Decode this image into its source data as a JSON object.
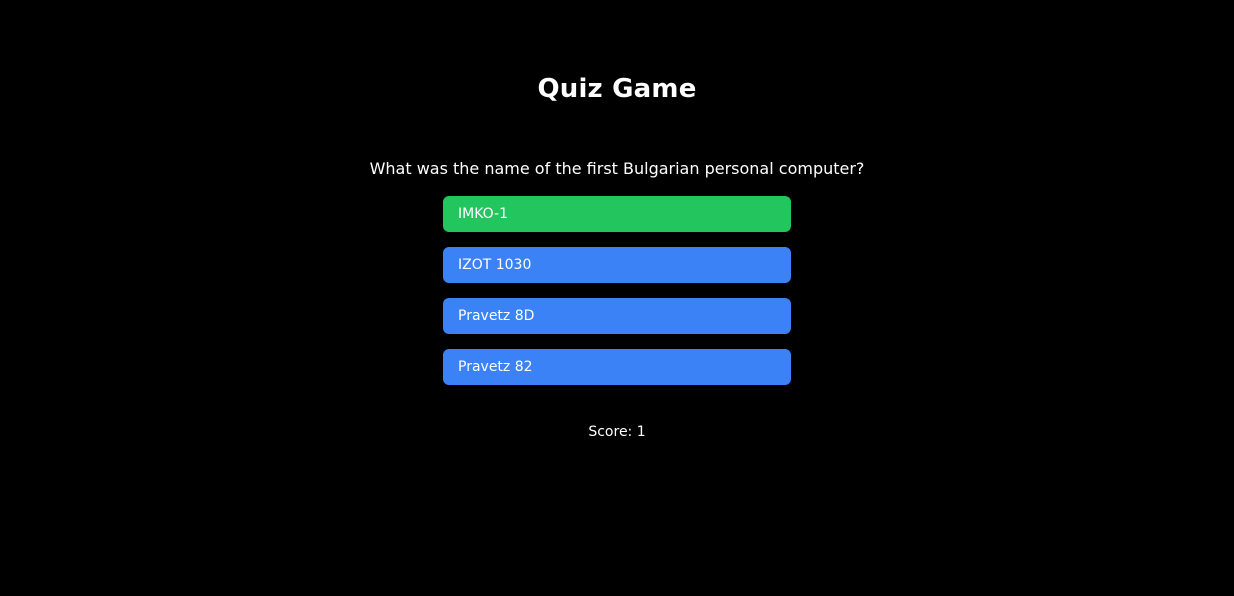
{
  "app": {
    "title": "Quiz Game"
  },
  "quiz": {
    "question": "What was the name of the first Bulgarian personal computer?",
    "answers": [
      {
        "label": "IMKO-1",
        "state": "correct",
        "color": "#22c55e"
      },
      {
        "label": "IZOT 1030",
        "state": "default",
        "color": "#3b82f6"
      },
      {
        "label": "Pravetz 8D",
        "state": "default",
        "color": "#3b82f6"
      },
      {
        "label": "Pravetz 82",
        "state": "default",
        "color": "#3b82f6"
      }
    ],
    "score_text": "Score: 1"
  },
  "theme": {
    "background": "#000000",
    "text": "#ffffff"
  }
}
